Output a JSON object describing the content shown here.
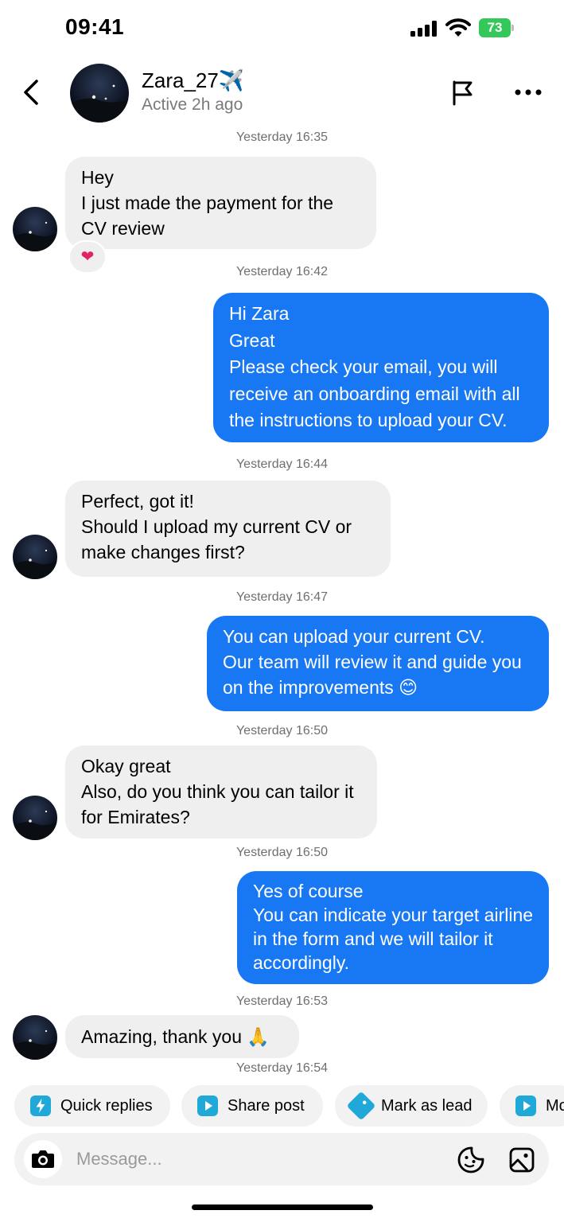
{
  "status_bar": {
    "time": "09:41",
    "battery": "73",
    "battery_color": "#34c759",
    "icons": [
      "signal-icon",
      "wifi-icon",
      "battery-icon"
    ]
  },
  "header": {
    "name": "Zara_27",
    "name_emoji": "✈️",
    "status": "Active 2h ago",
    "icons": [
      "back-icon",
      "flag-icon",
      "more-icon"
    ]
  },
  "conversation": [
    {
      "timestamp": "Yesterday 16:35",
      "direction": "incoming",
      "lines": [
        "Hey",
        "I just made the payment for the",
        "CV review"
      ],
      "reaction": "❤"
    },
    {
      "timestamp": "Yesterday 16:42",
      "direction": "outgoing",
      "lines": [
        "Hi Zara",
        "Great",
        "Please check your email, you will",
        "receive an onboarding email with all",
        "the instructions to upload your CV."
      ]
    },
    {
      "timestamp": "Yesterday 16:44",
      "direction": "incoming",
      "lines": [
        "Perfect, got it!",
        "Should I upload my current CV or",
        "make changes first?"
      ]
    },
    {
      "timestamp": "Yesterday 16:47",
      "direction": "outgoing",
      "lines": [
        "You can upload your current CV.",
        "Our team will review it and guide you",
        "on the improvements 😊"
      ]
    },
    {
      "timestamp": "Yesterday 16:50",
      "direction": "incoming",
      "lines": [
        "Okay great",
        "Also, do you think you can tailor it",
        "for Emirates?"
      ]
    },
    {
      "timestamp": "Yesterday 16:50",
      "direction": "outgoing",
      "lines": [
        "Yes of course",
        "You can indicate your target airline",
        "in the form and we will tailor it",
        "accordingly."
      ]
    },
    {
      "timestamp": "Yesterday 16:53",
      "direction": "incoming",
      "lines": [
        "Amazing, thank you 🙏"
      ]
    }
  ],
  "last_timestamp": "Yesterday 16:54",
  "quick_actions": [
    {
      "label": "Quick replies",
      "icon": "lightning-icon"
    },
    {
      "label": "Share post",
      "icon": "play-icon"
    },
    {
      "label": "Mark as lead",
      "icon": "tag-icon"
    },
    {
      "label": "Mo",
      "icon": "play-icon"
    }
  ],
  "composer": {
    "placeholder": "Message...",
    "icons": [
      "camera-icon",
      "sticker-icon",
      "gallery-icon"
    ]
  },
  "colors": {
    "outgoing_bubble": "#1877f2",
    "incoming_bubble": "#efefef",
    "action_icon": "#1fa8d8"
  }
}
